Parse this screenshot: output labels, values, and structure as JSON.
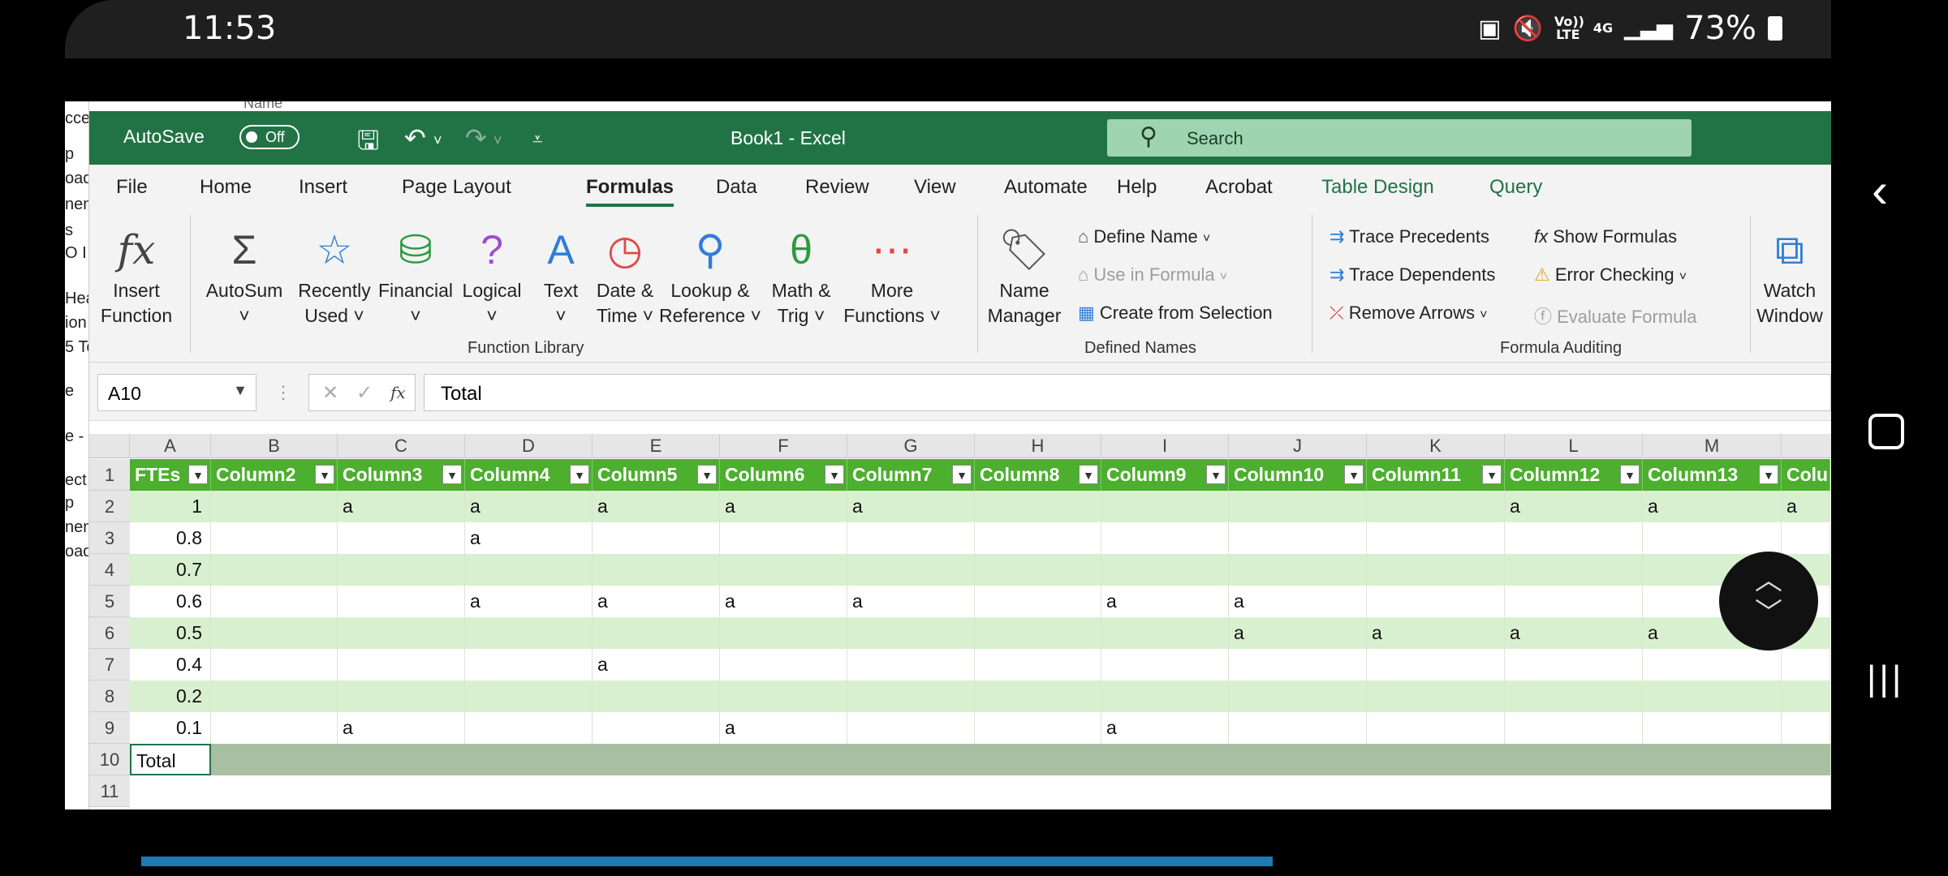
{
  "status": {
    "time": "11:53",
    "network": "Vo)) LTE",
    "gen": "4G",
    "battery": "73%"
  },
  "title_bar": {
    "autosave_label": "AutoSave",
    "autosave_state": "Off",
    "doc_title": "Book1 - Excel",
    "search_placeholder": "Search"
  },
  "tabs": [
    "File",
    "Home",
    "Insert",
    "Page Layout",
    "Formulas",
    "Data",
    "Review",
    "View",
    "Automate",
    "Help",
    "Acrobat",
    "Table Design",
    "Query"
  ],
  "active_tab": "Formulas",
  "ribbon": {
    "function_library": {
      "label": "Function Library",
      "buttons": [
        {
          "line1": "Insert",
          "line2": "Function",
          "icon": "fx-icon"
        },
        {
          "line1": "AutoSum",
          "line2": "˅",
          "icon": "sigma-icon"
        },
        {
          "line1": "Recently",
          "line2": "Used ˅",
          "icon": "star-book-icon"
        },
        {
          "line1": "Financial",
          "line2": "˅",
          "icon": "database-book-icon"
        },
        {
          "line1": "Logical",
          "line2": "˅",
          "icon": "question-book-icon"
        },
        {
          "line1": "Text",
          "line2": "˅",
          "icon": "text-book-icon"
        },
        {
          "line1": "Date &",
          "line2": "Time ˅",
          "icon": "clock-book-icon"
        },
        {
          "line1": "Lookup &",
          "line2": "Reference ˅",
          "icon": "magnifier-book-icon"
        },
        {
          "line1": "Math &",
          "line2": "Trig ˅",
          "icon": "theta-book-icon"
        },
        {
          "line1": "More",
          "line2": "Functions ˅",
          "icon": "dots-book-icon"
        }
      ]
    },
    "defined_names": {
      "label": "Defined Names",
      "name_manager": {
        "line1": "Name",
        "line2": "Manager"
      },
      "define_name": "Define Name",
      "use_in_formula": "Use in Formula",
      "create_from_selection": "Create from Selection"
    },
    "formula_auditing": {
      "label": "Formula Auditing",
      "trace_precedents": "Trace Precedents",
      "trace_dependents": "Trace Dependents",
      "remove_arrows": "Remove Arrows",
      "show_formulas": "Show Formulas",
      "error_checking": "Error Checking",
      "evaluate_formula": "Evaluate Formula",
      "watch_window": {
        "line1": "Watch",
        "line2": "Window"
      }
    }
  },
  "formula_bar": {
    "name_box": "A10",
    "content": "Total"
  },
  "grid": {
    "columns": [
      "A",
      "B",
      "C",
      "D",
      "E",
      "F",
      "G",
      "H",
      "I",
      "J",
      "K",
      "L",
      "M"
    ],
    "rows": [
      "1",
      "2",
      "3",
      "4",
      "5",
      "6",
      "7",
      "8",
      "9",
      "10",
      "11"
    ],
    "table_headers": [
      "FTEs",
      "Column2",
      "Column3",
      "Column4",
      "Column5",
      "Column6",
      "Column7",
      "Column8",
      "Column9",
      "Column10",
      "Column11",
      "Column12",
      "Column13",
      "Colu"
    ],
    "data": [
      [
        "1",
        "",
        "a",
        "a",
        "a",
        "a",
        "a",
        "",
        "",
        "",
        "",
        "a",
        "a",
        "a"
      ],
      [
        "0.8",
        "",
        "",
        "a",
        "",
        "",
        "",
        "",
        "",
        "",
        "",
        "",
        "",
        ""
      ],
      [
        "0.7",
        "",
        "",
        "",
        "",
        "",
        "",
        "",
        "",
        "",
        "",
        "",
        "",
        ""
      ],
      [
        "0.6",
        "",
        "",
        "a",
        "a",
        "a",
        "a",
        "",
        "a",
        "a",
        "",
        "",
        "",
        ""
      ],
      [
        "0.5",
        "",
        "",
        "",
        "",
        "",
        "",
        "",
        "",
        "a",
        "a",
        "a",
        "a",
        ""
      ],
      [
        "0.4",
        "",
        "",
        "",
        "a",
        "",
        "",
        "",
        "",
        "",
        "",
        "",
        "",
        ""
      ],
      [
        "0.2",
        "",
        "",
        "",
        "",
        "",
        "",
        "",
        "",
        "",
        "",
        "",
        "",
        ""
      ],
      [
        "0.1",
        "",
        "a",
        "",
        "",
        "a",
        "",
        "",
        "a",
        "",
        "",
        "",
        "",
        ""
      ]
    ],
    "total_label": "Total"
  },
  "behind_window_text": [
    "cce",
    "p",
    "oad",
    "nen",
    "s",
    "O I",
    "Hea",
    "ion",
    "5 To",
    "e",
    "e -",
    "ect",
    "p",
    "nen",
    "oad"
  ],
  "behind_top_text": "Name"
}
